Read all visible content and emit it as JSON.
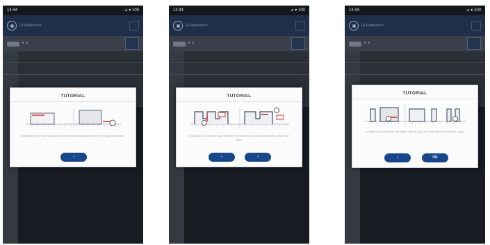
{
  "status_bar": {
    "time": "14:44",
    "right": "⊿ ▾ 100"
  },
  "app": {
    "title": "UI Reference",
    "toolbar_label": "• •"
  },
  "dialog": {
    "title": "TUTORIAL"
  },
  "screens": [
    {
      "text": "In tutorial 1 the note is shown a moment, step the gradient of time drag and release.",
      "buttons": [
        "›"
      ]
    },
    {
      "text": "In tutorial 2 the tap the spot between the notes to, and one tap where to place the time.",
      "buttons": [
        "‹",
        "›"
      ]
    },
    {
      "text": "In tutorial 3 from where the single has the row, and note with the pointer to drag.",
      "buttons": [
        "‹",
        "OK"
      ]
    }
  ],
  "colors": {
    "accent": "#16478c",
    "marker": "#e02b2b",
    "app_bar": "#1f2f4a"
  }
}
